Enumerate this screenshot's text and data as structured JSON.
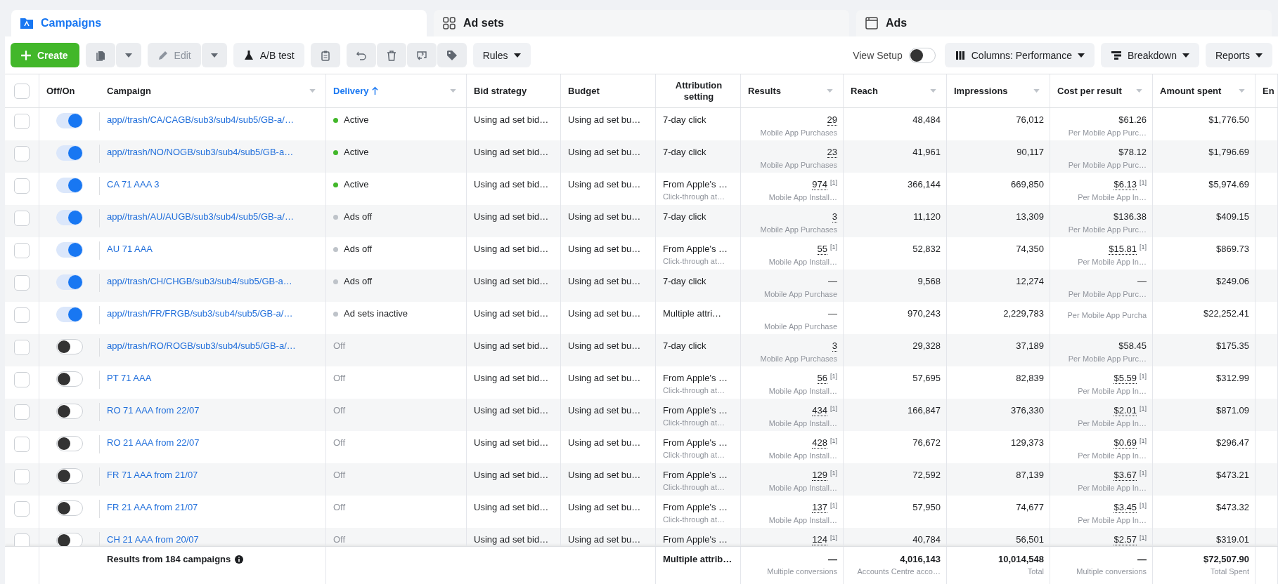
{
  "tabs": [
    {
      "label": "Campaigns",
      "selected": true
    },
    {
      "label": "Ad sets",
      "selected": false
    },
    {
      "label": "Ads",
      "selected": false
    }
  ],
  "toolbar": {
    "create": "Create",
    "edit": {
      "label": "Edit",
      "disabled": true
    },
    "ab_test": "A/B test",
    "rules": "Rules",
    "view_setup": {
      "label": "View Setup",
      "on": false
    },
    "columns": "Columns: Performance",
    "breakdown": "Breakdown",
    "reports": "Reports"
  },
  "table": {
    "select_all_checked": false,
    "columns": [
      {
        "label": "Off/On",
        "menu": false,
        "sorted": false
      },
      {
        "label": "Campaign",
        "menu": true,
        "sorted": false
      },
      {
        "label": "Delivery",
        "menu": true,
        "sorted": true
      },
      {
        "label": "Bid strategy",
        "menu": false,
        "sorted": false
      },
      {
        "label": "Budget",
        "menu": false,
        "sorted": false
      },
      {
        "label": "Attribution setting",
        "menu": false,
        "sorted": false
      },
      {
        "label": "Results",
        "menu": true,
        "sorted": false
      },
      {
        "label": "Reach",
        "menu": true,
        "sorted": false
      },
      {
        "label": "Impressions",
        "menu": true,
        "sorted": false
      },
      {
        "label": "Cost per result",
        "menu": true,
        "sorted": false
      },
      {
        "label": "Amount spent",
        "menu": true,
        "sorted": false
      },
      {
        "label": "En",
        "menu": false,
        "sorted": false
      }
    ],
    "rows": [
      {
        "checked": false,
        "on": true,
        "campaign": "app//trash/CA/CAGB/sub3/sub4/sub5/GB-a/…",
        "delivery": {
          "text": "Active",
          "color": "#42b72a"
        },
        "bid": "Using ad set bid…",
        "budget": "Using ad set bu…",
        "attribution": {
          "text": "7-day click"
        },
        "results": {
          "value": "29",
          "dotted": true,
          "sub": "Mobile App Purchases"
        },
        "reach": "48,484",
        "impressions": "76,012",
        "cost": {
          "value": "$61.26",
          "dotted": false,
          "sub": "Per Mobile App Purc…"
        },
        "amount": "$1,776.50"
      },
      {
        "checked": false,
        "on": true,
        "campaign": "app//trash/NO/NOGB/sub3/sub4/sub5/GB-a…",
        "delivery": {
          "text": "Active",
          "color": "#42b72a"
        },
        "bid": "Using ad set bid…",
        "budget": "Using ad set bu…",
        "attribution": {
          "text": "7-day click"
        },
        "results": {
          "value": "23",
          "dotted": true,
          "sub": "Mobile App Purchases"
        },
        "reach": "41,961",
        "impressions": "90,117",
        "cost": {
          "value": "$78.12",
          "dotted": false,
          "sub": "Per Mobile App Purc…"
        },
        "amount": "$1,796.69"
      },
      {
        "checked": false,
        "on": true,
        "campaign": "CA 71 AAA 3",
        "delivery": {
          "text": "Active",
          "color": "#42b72a"
        },
        "bid": "Using ad set bid…",
        "budget": "Using ad set bu…",
        "attribution": {
          "text": "From Apple's …",
          "sub": "Click-through at…"
        },
        "results": {
          "value": "974",
          "note": "[1]",
          "dotted": true,
          "sub": "Mobile App Install…"
        },
        "reach": "366,144",
        "impressions": "669,850",
        "cost": {
          "value": "$6.13",
          "note": "[1]",
          "dotted": true,
          "sub": "Per Mobile App In…"
        },
        "amount": "$5,974.69"
      },
      {
        "checked": false,
        "on": true,
        "campaign": "app//trash/AU/AUGB/sub3/sub4/sub5/GB-a/…",
        "delivery": {
          "text": "Ads off",
          "color": "#bec3c9"
        },
        "bid": "Using ad set bid…",
        "budget": "Using ad set bu…",
        "attribution": {
          "text": "7-day click"
        },
        "results": {
          "value": "3",
          "dotted": true,
          "sub": "Mobile App Purchases"
        },
        "reach": "11,120",
        "impressions": "13,309",
        "cost": {
          "value": "$136.38",
          "dotted": false,
          "sub": "Per Mobile App Purc…"
        },
        "amount": "$409.15"
      },
      {
        "checked": false,
        "on": true,
        "campaign": "AU 71 AAA",
        "delivery": {
          "text": "Ads off",
          "color": "#bec3c9"
        },
        "bid": "Using ad set bid…",
        "budget": "Using ad set bu…",
        "attribution": {
          "text": "From Apple's …",
          "sub": "Click-through at…"
        },
        "results": {
          "value": "55",
          "note": "[1]",
          "dotted": true,
          "sub": "Mobile App Install…"
        },
        "reach": "52,832",
        "impressions": "74,350",
        "cost": {
          "value": "$15.81",
          "note": "[1]",
          "dotted": true,
          "sub": "Per Mobile App In…"
        },
        "amount": "$869.73"
      },
      {
        "checked": false,
        "on": true,
        "campaign": "app//trash/CH/CHGB/sub3/sub4/sub5/GB-a…",
        "delivery": {
          "text": "Ads off",
          "color": "#bec3c9"
        },
        "bid": "Using ad set bid…",
        "budget": "Using ad set bu…",
        "attribution": {
          "text": "7-day click"
        },
        "results": {
          "value": "—",
          "dotted": false,
          "sub": "Mobile App Purchase"
        },
        "reach": "9,568",
        "impressions": "12,274",
        "cost": {
          "value": "—",
          "dotted": false,
          "sub": "Per Mobile App Purc…"
        },
        "amount": "$249.06"
      },
      {
        "checked": false,
        "on": true,
        "campaign": "app//trash/FR/FRGB/sub3/sub4/sub5/GB-a/…",
        "delivery": {
          "text": "Ad sets inactive",
          "color": "#bec3c9"
        },
        "bid": "Using ad set bid…",
        "budget": "Using ad set bu…",
        "attribution": {
          "text": "Multiple attri…"
        },
        "results": {
          "value": "—",
          "dotted": false,
          "sub": "Mobile App Purchase"
        },
        "reach": "970,243",
        "impressions": "2,229,783",
        "cost": {
          "sub": "Per Mobile App Purcha"
        },
        "amount": "$22,252.41"
      },
      {
        "checked": false,
        "on": false,
        "campaign": "app//trash/RO/ROGB/sub3/sub4/sub5/GB-a/…",
        "delivery": {
          "text": "Off"
        },
        "bid": "Using ad set bid…",
        "budget": "Using ad set bu…",
        "attribution": {
          "text": "7-day click"
        },
        "results": {
          "value": "3",
          "dotted": true,
          "sub": "Mobile App Purchases"
        },
        "reach": "29,328",
        "impressions": "37,189",
        "cost": {
          "value": "$58.45",
          "dotted": false,
          "sub": "Per Mobile App Purc…"
        },
        "amount": "$175.35"
      },
      {
        "checked": false,
        "on": false,
        "campaign": "PT 71 AAA",
        "delivery": {
          "text": "Off"
        },
        "bid": "Using ad set bid…",
        "budget": "Using ad set bu…",
        "attribution": {
          "text": "From Apple's …",
          "sub": "Click-through at…"
        },
        "results": {
          "value": "56",
          "note": "[1]",
          "dotted": true,
          "sub": "Mobile App Install…"
        },
        "reach": "57,695",
        "impressions": "82,839",
        "cost": {
          "value": "$5.59",
          "note": "[1]",
          "dotted": true,
          "sub": "Per Mobile App In…"
        },
        "amount": "$312.99"
      },
      {
        "checked": false,
        "on": false,
        "campaign": "RO 71 AAA from 22/07",
        "delivery": {
          "text": "Off"
        },
        "bid": "Using ad set bid…",
        "budget": "Using ad set bu…",
        "attribution": {
          "text": "From Apple's …",
          "sub": "Click-through at…"
        },
        "results": {
          "value": "434",
          "note": "[1]",
          "dotted": true,
          "sub": "Mobile App Install…"
        },
        "reach": "166,847",
        "impressions": "376,330",
        "cost": {
          "value": "$2.01",
          "note": "[1]",
          "dotted": true,
          "sub": "Per Mobile App In…"
        },
        "amount": "$871.09"
      },
      {
        "checked": false,
        "on": false,
        "campaign": "RO 21 AAA from 22/07",
        "delivery": {
          "text": "Off"
        },
        "bid": "Using ad set bid…",
        "budget": "Using ad set bu…",
        "attribution": {
          "text": "From Apple's …",
          "sub": "Click-through at…"
        },
        "results": {
          "value": "428",
          "note": "[1]",
          "dotted": true,
          "sub": "Mobile App Install…"
        },
        "reach": "76,672",
        "impressions": "129,373",
        "cost": {
          "value": "$0.69",
          "note": "[1]",
          "dotted": true,
          "sub": "Per Mobile App In…"
        },
        "amount": "$296.47"
      },
      {
        "checked": false,
        "on": false,
        "campaign": "FR 71 AAA from 21/07",
        "delivery": {
          "text": "Off"
        },
        "bid": "Using ad set bid…",
        "budget": "Using ad set bu…",
        "attribution": {
          "text": "From Apple's …",
          "sub": "Click-through at…"
        },
        "results": {
          "value": "129",
          "note": "[1]",
          "dotted": true,
          "sub": "Mobile App Install…"
        },
        "reach": "72,592",
        "impressions": "87,139",
        "cost": {
          "value": "$3.67",
          "note": "[1]",
          "dotted": true,
          "sub": "Per Mobile App In…"
        },
        "amount": "$473.21"
      },
      {
        "checked": false,
        "on": false,
        "campaign": "FR 21 AAA from 21/07",
        "delivery": {
          "text": "Off"
        },
        "bid": "Using ad set bid…",
        "budget": "Using ad set bu…",
        "attribution": {
          "text": "From Apple's …",
          "sub": "Click-through at…"
        },
        "results": {
          "value": "137",
          "note": "[1]",
          "dotted": true,
          "sub": "Mobile App Install…"
        },
        "reach": "57,950",
        "impressions": "74,677",
        "cost": {
          "value": "$3.45",
          "note": "[1]",
          "dotted": true,
          "sub": "Per Mobile App In…"
        },
        "amount": "$473.32"
      },
      {
        "checked": false,
        "on": false,
        "campaign": "CH 21 AAA from 20/07",
        "delivery": {
          "text": "Off"
        },
        "bid": "Using ad set bid…",
        "budget": "Using ad set bu…",
        "attribution": {
          "text": "From Apple's …"
        },
        "results": {
          "value": "124",
          "note": "[1]",
          "dotted": true
        },
        "reach": "40,784",
        "impressions": "56,501",
        "cost": {
          "value": "$2.57",
          "note": "[1]",
          "dotted": true
        },
        "amount": "$319.01"
      }
    ],
    "footer": {
      "label": "Results from 184 campaigns",
      "attribution": "Multiple attrib…",
      "results": {
        "value": "—",
        "sub": "Multiple conversions"
      },
      "reach": {
        "value": "4,016,143",
        "sub": "Accounts Centre acco…"
      },
      "impressions": {
        "value": "10,014,548",
        "sub": "Total"
      },
      "cost": {
        "value": "—",
        "sub": "Multiple conversions"
      },
      "amount": {
        "value": "$72,507.90",
        "sub": "Total Spent"
      }
    }
  }
}
